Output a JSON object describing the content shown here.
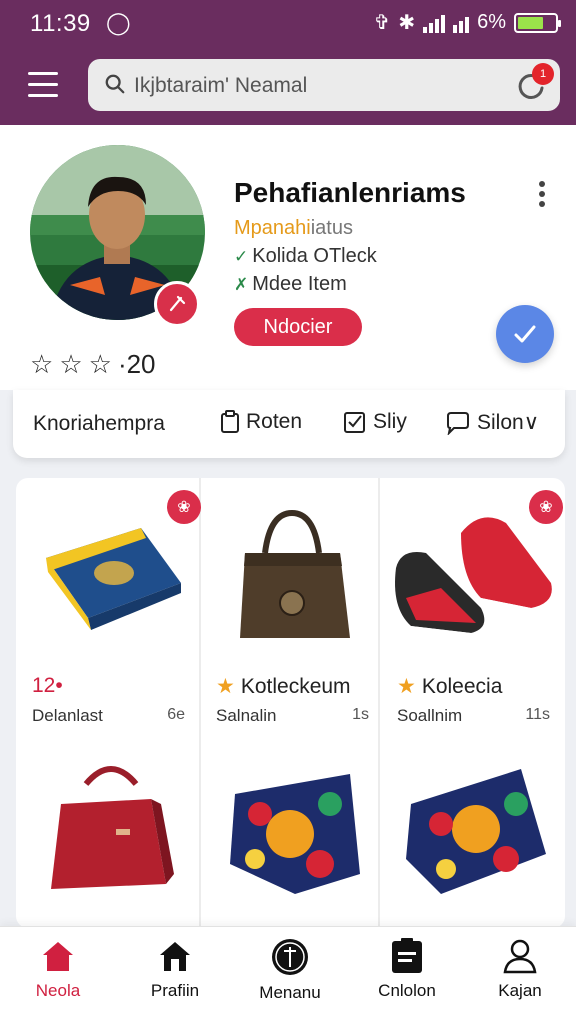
{
  "status_bar": {
    "time": "11:39",
    "battery": "6%"
  },
  "search": {
    "placeholder": "Ikjbtaraim' Neamal",
    "notification_badge": "1"
  },
  "profile": {
    "name": "Pehafianlenriams",
    "role_highlight": "Mpanahi",
    "role_rest": "iatus",
    "line1": "Kolida OTleck",
    "line2": "Mdee Item",
    "follow_label": "Ndocier",
    "rating": "·20"
  },
  "tabs": [
    {
      "label": "Knoriahempra",
      "icon": "none"
    },
    {
      "label": "Roten",
      "icon": "clipboard-icon"
    },
    {
      "label": "Sliy",
      "icon": "checkbox-icon"
    },
    {
      "label": "Silon∨",
      "icon": "chat-icon"
    }
  ],
  "products": [
    {
      "title": "12•",
      "title_style": "red",
      "subtitle": "Delanlast",
      "count": "6e",
      "item": "folded blue-yellow jersey"
    },
    {
      "title": "Kotleckeum",
      "title_style": "star",
      "subtitle": "Salnalin",
      "count": "1s",
      "item": "brown leather tote bag"
    },
    {
      "title": "Koleecia",
      "title_style": "star",
      "subtitle": "Soallnim",
      "count": "11s",
      "item": "red black sneakers"
    },
    {
      "title": "",
      "title_style": "none",
      "subtitle": "",
      "count": "",
      "item": "red shoulder bag"
    },
    {
      "title": "",
      "title_style": "none",
      "subtitle": "",
      "count": "",
      "item": "floral swim shorts"
    },
    {
      "title": "",
      "title_style": "none",
      "subtitle": "",
      "count": "",
      "item": "floral swim shorts folded"
    }
  ],
  "bottom_nav": [
    {
      "label": "Neola",
      "icon": "home-icon",
      "active": true
    },
    {
      "label": "Prafiin",
      "icon": "store-icon",
      "active": false
    },
    {
      "label": "Menanu",
      "icon": "compass-icon",
      "active": false
    },
    {
      "label": "Cnlolon",
      "icon": "document-icon",
      "active": false
    },
    {
      "label": "Kajan",
      "icon": "user-icon",
      "active": false
    }
  ],
  "colors": {
    "header": "#6a2d5f",
    "accent": "#da2e4a",
    "fab": "#5b87e6",
    "role": "#e59a1a"
  }
}
